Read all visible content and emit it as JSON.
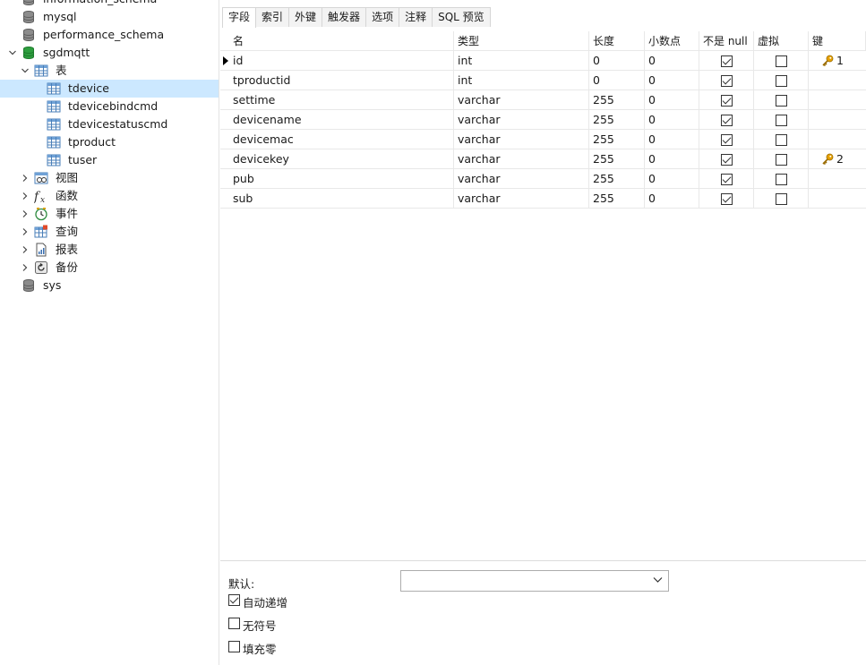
{
  "sidebar": {
    "items": [
      {
        "label": "information_schema",
        "level": 1,
        "icon": "database-icon",
        "expand": "none"
      },
      {
        "label": "mysql",
        "level": 1,
        "icon": "database-icon",
        "expand": "none"
      },
      {
        "label": "performance_schema",
        "level": 1,
        "icon": "database-icon",
        "expand": "none"
      },
      {
        "label": "sgdmqtt",
        "level": 1,
        "icon": "database-open-icon",
        "expand": "open"
      },
      {
        "label": "表",
        "level": 2,
        "icon": "tables-icon",
        "expand": "open"
      },
      {
        "label": "tdevice",
        "level": 3,
        "icon": "table-icon",
        "expand": "none",
        "selected": true
      },
      {
        "label": "tdevicebindcmd",
        "level": 3,
        "icon": "table-icon",
        "expand": "none"
      },
      {
        "label": "tdevicestatuscmd",
        "level": 3,
        "icon": "table-icon",
        "expand": "none"
      },
      {
        "label": "tproduct",
        "level": 3,
        "icon": "table-icon",
        "expand": "none"
      },
      {
        "label": "tuser",
        "level": 3,
        "icon": "table-icon",
        "expand": "none"
      },
      {
        "label": "视图",
        "level": 2,
        "icon": "view-icon",
        "expand": "closed"
      },
      {
        "label": "函数",
        "level": 2,
        "icon": "function-icon",
        "expand": "closed"
      },
      {
        "label": "事件",
        "level": 2,
        "icon": "event-clock-icon",
        "expand": "closed"
      },
      {
        "label": "查询",
        "level": 2,
        "icon": "query-icon",
        "expand": "closed"
      },
      {
        "label": "报表",
        "level": 2,
        "icon": "report-icon",
        "expand": "closed"
      },
      {
        "label": "备份",
        "level": 2,
        "icon": "backup-icon",
        "expand": "closed"
      },
      {
        "label": "sys",
        "level": 1,
        "icon": "database-icon",
        "expand": "none"
      }
    ]
  },
  "tabs": [
    "字段",
    "索引",
    "外键",
    "触发器",
    "选项",
    "注释",
    "SQL 预览"
  ],
  "grid": {
    "columns": [
      "名",
      "类型",
      "长度",
      "小数点",
      "不是 null",
      "虚拟",
      "键"
    ],
    "rows": [
      {
        "name": "id",
        "type": "int",
        "length": "0",
        "decimals": "0",
        "not_null": true,
        "virtual": false,
        "key": "1"
      },
      {
        "name": "tproductid",
        "type": "int",
        "length": "0",
        "decimals": "0",
        "not_null": true,
        "virtual": false,
        "key": ""
      },
      {
        "name": "settime",
        "type": "varchar",
        "length": "255",
        "decimals": "0",
        "not_null": true,
        "virtual": false,
        "key": ""
      },
      {
        "name": "devicename",
        "type": "varchar",
        "length": "255",
        "decimals": "0",
        "not_null": true,
        "virtual": false,
        "key": ""
      },
      {
        "name": "devicemac",
        "type": "varchar",
        "length": "255",
        "decimals": "0",
        "not_null": true,
        "virtual": false,
        "key": ""
      },
      {
        "name": "devicekey",
        "type": "varchar",
        "length": "255",
        "decimals": "0",
        "not_null": true,
        "virtual": false,
        "key": "2"
      },
      {
        "name": "pub",
        "type": "varchar",
        "length": "255",
        "decimals": "0",
        "not_null": true,
        "virtual": false,
        "key": ""
      },
      {
        "name": "sub",
        "type": "varchar",
        "length": "255",
        "decimals": "0",
        "not_null": true,
        "virtual": false,
        "key": ""
      }
    ]
  },
  "bottom": {
    "default_label": "默认:",
    "default_value": "",
    "auto_increment_label": "自动递增",
    "auto_increment_checked": true,
    "unsigned_label": "无符号",
    "unsigned_checked": false,
    "zerofill_label": "填充零",
    "zerofill_checked": false
  },
  "colors": {
    "selected": "#cce8ff",
    "db_active": "#2e9e3f",
    "key": "#e6a100"
  }
}
